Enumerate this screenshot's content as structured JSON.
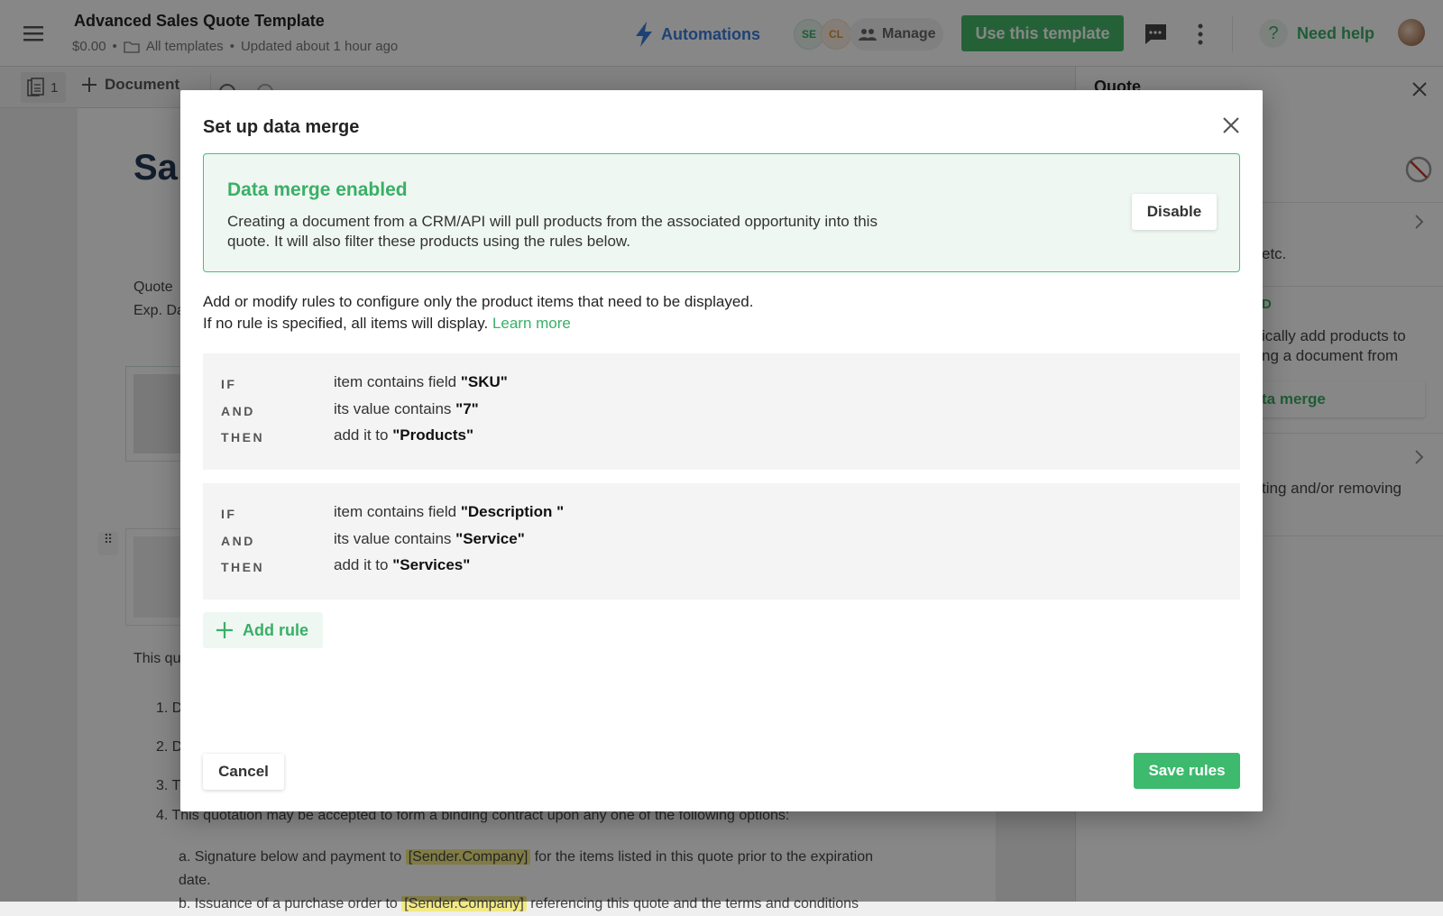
{
  "header": {
    "title": "Advanced Sales Quote Template",
    "price": "$0.00",
    "folder": "All templates",
    "updated": "Updated about 1 hour ago",
    "automations": "Automations",
    "avatars": [
      "SE",
      "CL"
    ],
    "manage": "Manage",
    "use_template": "Use this template",
    "need_help": "Need help",
    "help_glyph": "?",
    "colors": {
      "accent_green": "#3dba6d",
      "automations_blue": "#3b7ddd"
    }
  },
  "toolbar": {
    "page_count": "1",
    "add_document": "Document"
  },
  "document": {
    "title_fragment": "Sa",
    "quote_fragment": "Quote",
    "exp_fragment": "Exp. Da",
    "intro_fragment": "This qu",
    "items": [
      "1. D",
      "2. D",
      "3. T"
    ],
    "item4": "4. This quotation may be accepted to form a binding contract upon any one of the following options:",
    "sub_a_pre": "a. Signature below and payment to",
    "sender_company": "[Sender.Company]",
    "sub_a_post": "for the items listed in this quote prior to the expiration",
    "sub_a_end": "date.",
    "sub_b_pre": "b. Issuance of a purchase order to",
    "sub_b_post": "referencing this quote and the terms and conditions"
  },
  "right_panel": {
    "title": "Quote",
    "frag1": "etc.",
    "frag_green": "D",
    "frag2": "ically add products to",
    "frag3": "ng a document from",
    "frag_button": "ta merge",
    "frag4": "ting and/or removing"
  },
  "modal": {
    "title": "Set up data merge",
    "banner": {
      "heading": "Data merge enabled",
      "text": "Creating a document from a CRM/API will pull products from the associated opportunity into this quote. It will also filter these products using the rules below.",
      "disable": "Disable"
    },
    "intro_line1": "Add or modify rules to configure only the product items that need to be displayed.",
    "intro_line2": "If no rule is specified, all items will display.",
    "learn_more": "Learn more",
    "rules": [
      {
        "if_kw": "IF",
        "if_text": "item contains field",
        "if_val": "\"SKU\"",
        "and_kw": "AND",
        "and_text": "its value contains",
        "and_val": "\"7\"",
        "then_kw": "THEN",
        "then_text": "add it to",
        "then_val": "\"Products\""
      },
      {
        "if_kw": "IF",
        "if_text": "item contains field",
        "if_val": "\"Description \"",
        "and_kw": "AND",
        "and_text": "its value contains",
        "and_val": "\"Service\"",
        "then_kw": "THEN",
        "then_text": "add it to",
        "then_val": "\"Services\""
      }
    ],
    "add_rule": "Add rule",
    "cancel": "Cancel",
    "save": "Save rules"
  }
}
